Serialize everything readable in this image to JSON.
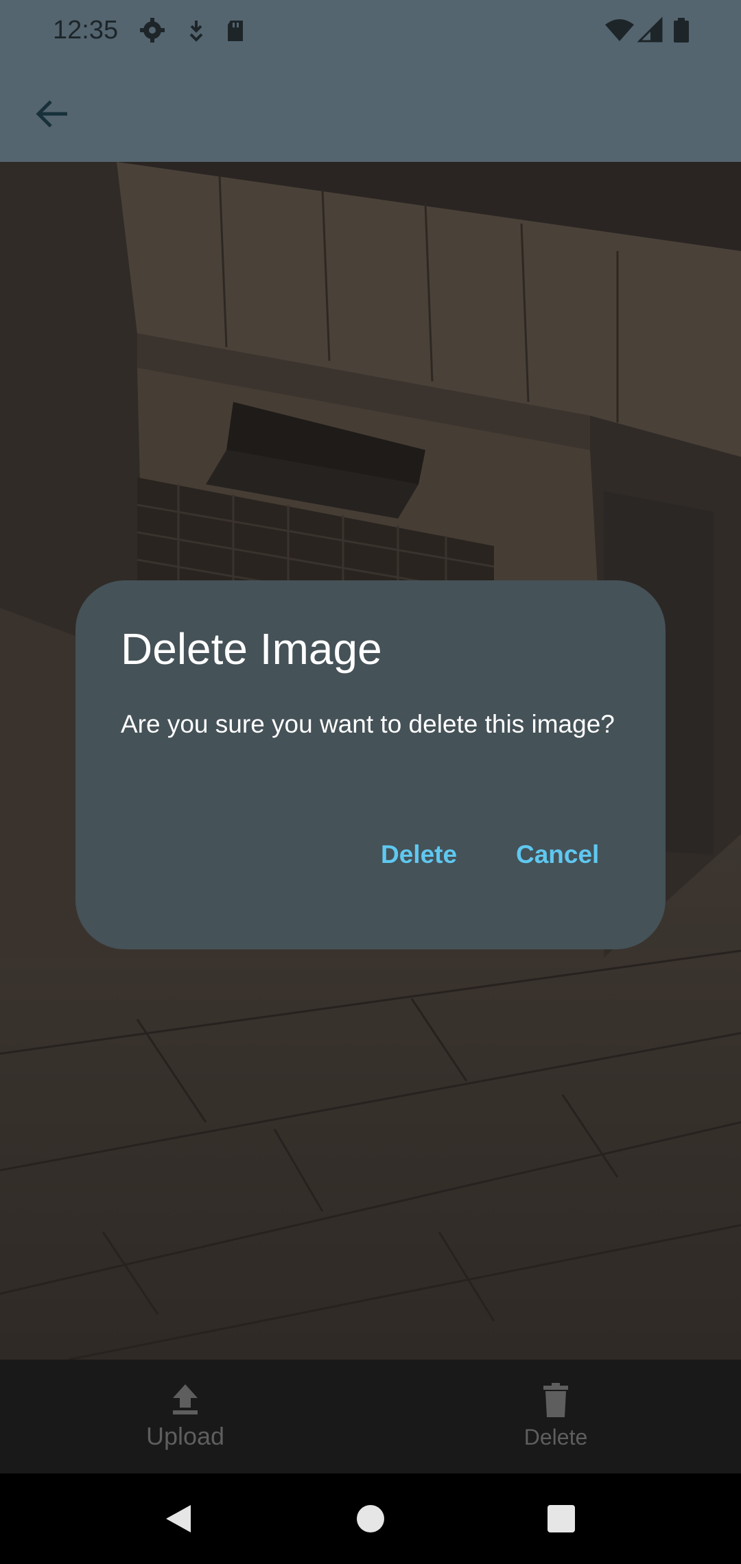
{
  "status_bar": {
    "time": "12:35",
    "icons_left": [
      "settings-gear-icon",
      "download-arrow-icon",
      "sd-card-icon"
    ],
    "icons_right": [
      "wifi-icon",
      "signal-icon",
      "battery-icon"
    ]
  },
  "app_bar": {
    "back_icon": "arrow-back-icon"
  },
  "dialog": {
    "title": "Delete Image",
    "message": "Are you sure you want to delete this image?",
    "confirm_label": "Delete",
    "cancel_label": "Cancel"
  },
  "bottom_bar": {
    "upload_label": "Upload",
    "upload_icon": "upload-icon",
    "delete_label": "Delete",
    "delete_icon": "trash-icon"
  },
  "nav_bar": {
    "back": "nav-back-icon",
    "home": "nav-home-icon",
    "recents": "nav-recents-icon"
  },
  "colors": {
    "app_bar": "#546570",
    "dialog_bg": "#455258",
    "dialog_button": "#5fc8f0",
    "bottom_bar": "#191919"
  }
}
